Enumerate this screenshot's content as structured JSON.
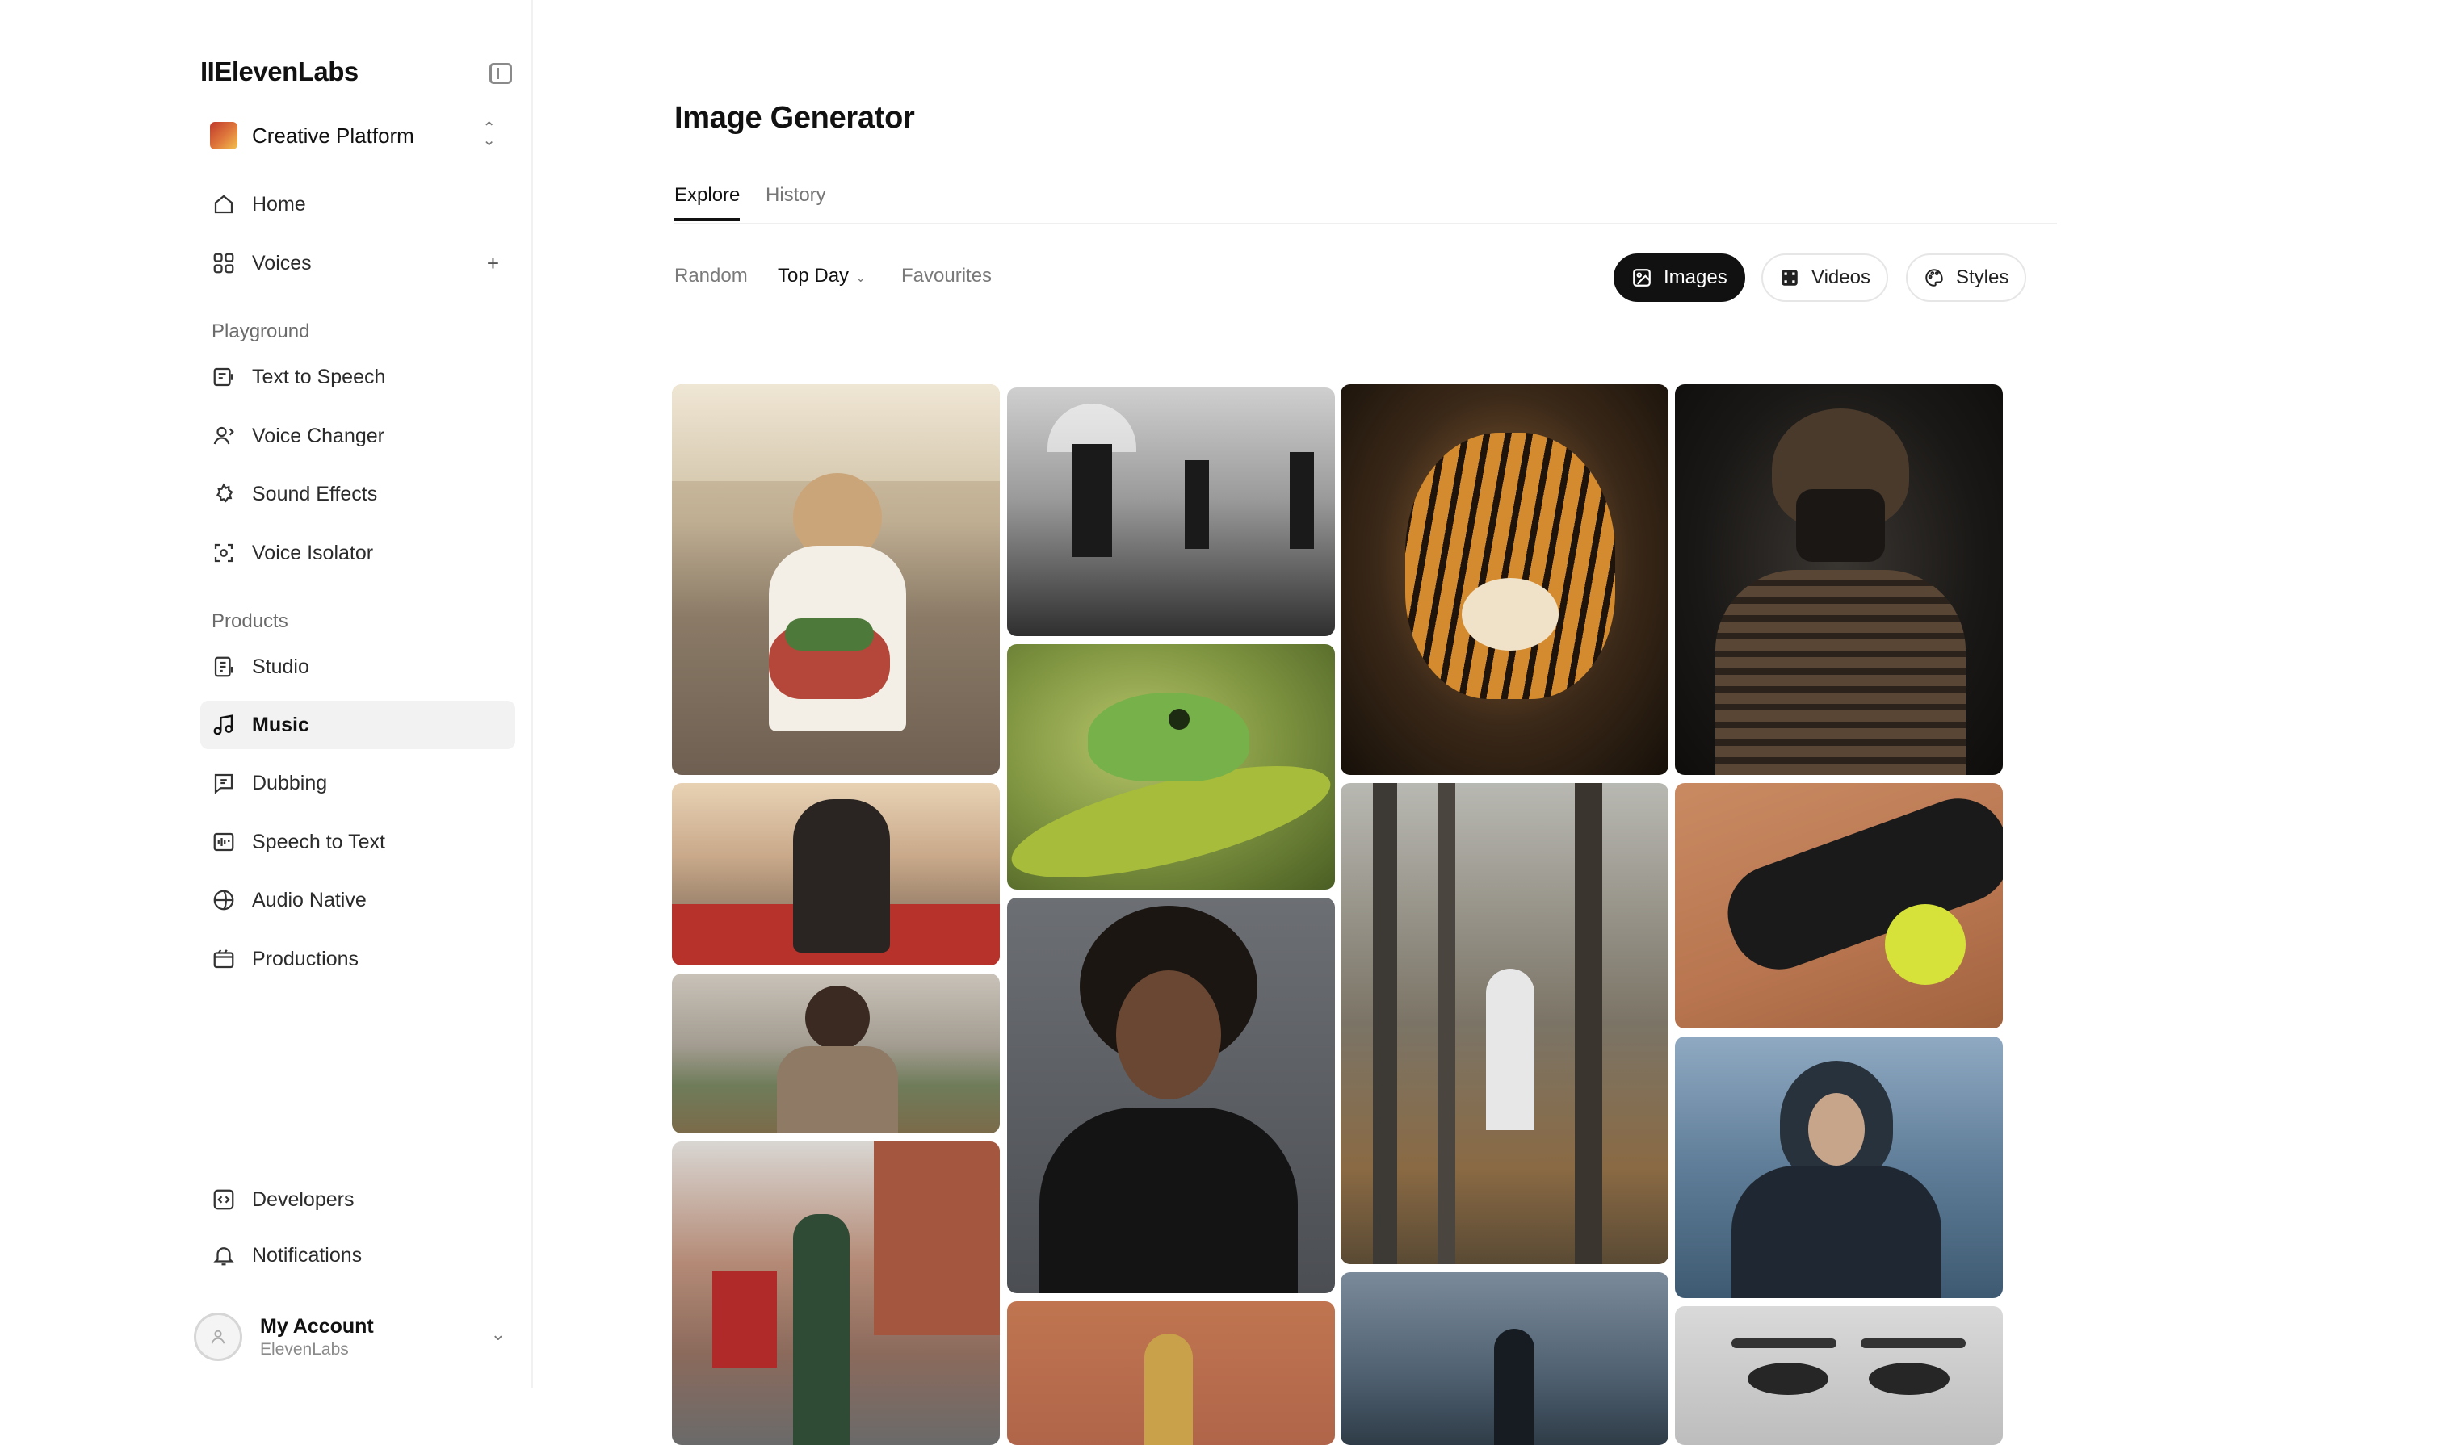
{
  "sidebar": {
    "brand": "IIElevenLabs",
    "workspace": "Creative Platform",
    "items_top": [
      {
        "label": "Home",
        "icon": "home-icon"
      },
      {
        "label": "Voices",
        "icon": "voices-icon"
      }
    ],
    "sections": [
      {
        "title": "Playground",
        "items": [
          {
            "label": "Text to Speech",
            "icon": "text-to-speech-icon"
          },
          {
            "label": "Voice Changer",
            "icon": "voice-changer-icon"
          },
          {
            "label": "Sound Effects",
            "icon": "sound-effects-icon"
          },
          {
            "label": "Voice Isolator",
            "icon": "voice-isolator-icon"
          }
        ]
      },
      {
        "title": "Products",
        "items": [
          {
            "label": "Studio",
            "icon": "studio-icon"
          },
          {
            "label": "Music",
            "icon": "music-icon",
            "active": true
          },
          {
            "label": "Dubbing",
            "icon": "dubbing-icon"
          },
          {
            "label": "Speech to Text",
            "icon": "speech-to-text-icon"
          },
          {
            "label": "Audio Native",
            "icon": "audio-native-icon"
          },
          {
            "label": "Productions",
            "icon": "productions-icon"
          }
        ]
      }
    ],
    "items_bottom": [
      {
        "label": "Developers",
        "icon": "developers-icon"
      },
      {
        "label": "Notifications",
        "icon": "bell-icon"
      }
    ],
    "account": {
      "name": "My Account",
      "org": "ElevenLabs"
    }
  },
  "main": {
    "title": "Image Generator",
    "tabs": [
      {
        "label": "Explore",
        "active": true
      },
      {
        "label": "History",
        "active": false
      }
    ],
    "filters": [
      {
        "label": "Random",
        "active": false
      },
      {
        "label": "Top Day",
        "active": true,
        "dropdown": true
      },
      {
        "label": "Favourites",
        "active": false
      }
    ],
    "media_types": [
      {
        "label": "Images",
        "icon": "image-icon",
        "active": true
      },
      {
        "label": "Videos",
        "icon": "video-icon",
        "active": false
      },
      {
        "label": "Styles",
        "icon": "palette-icon",
        "active": false
      }
    ]
  },
  "colors": {
    "accent": "#111111",
    "muted_text": "#7a7a7a",
    "active_nav_bg": "#f2f2f2"
  }
}
